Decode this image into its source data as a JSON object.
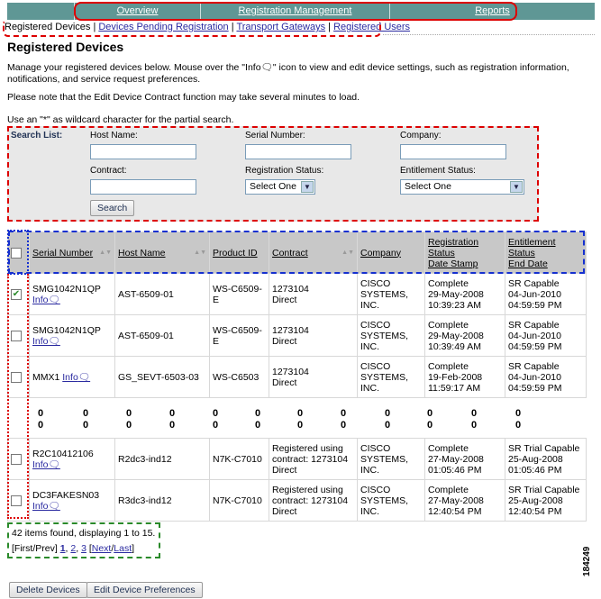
{
  "nav": {
    "items": [
      "Overview",
      "Registration Management",
      "Reports"
    ]
  },
  "subnav": {
    "current": "Registered Devices",
    "links": [
      "Devices Pending Registration",
      "Transport Gateways",
      "Registered Users"
    ],
    "sep": "|"
  },
  "title": "Registered Devices",
  "intro": {
    "p1a": "Manage your registered devices below. Mouse over the \"Info",
    "p1b": "\" icon to view and edit device settings, such as registration information, notifications, and service request preferences.",
    "p2": "Please note that the Edit Device Contract function may take several minutes to load.",
    "p3": "Use an \"*\" as wildcard character for the partial search."
  },
  "search": {
    "heading": "Search List:",
    "host_label": "Host Name:",
    "serial_label": "Serial Number:",
    "company_label": "Company:",
    "contract_label": "Contract:",
    "reg_status_label": "Registration Status:",
    "reg_status_value": "Select One",
    "ent_status_label": "Entitlement Status:",
    "ent_status_value": "Select One",
    "search_button": "Search"
  },
  "table": {
    "headers": [
      "Serial Number",
      "Host Name",
      "Product ID",
      "Contract",
      "Company",
      "Registration Status Date Stamp",
      "Entitlement Status End Date"
    ],
    "header_lines": {
      "reg": [
        "Registration",
        "Status",
        "Date Stamp"
      ],
      "ent": [
        "Entitlement Status",
        "End Date"
      ]
    },
    "info_label": "Info",
    "rows": [
      {
        "checked": true,
        "serial": "SMG1042N1QP",
        "host": "AST-6509-01",
        "product": "WS-C6509-E",
        "contract": [
          "1273104",
          "Direct"
        ],
        "company": [
          "CISCO",
          "SYSTEMS, INC."
        ],
        "reg": [
          "Complete",
          "29-May-2008",
          "10:39:23 AM"
        ],
        "ent": [
          "SR Capable",
          "04-Jun-2010",
          "04:59:59 PM"
        ]
      },
      {
        "checked": false,
        "serial": "SMG1042N1QP",
        "host": "AST-6509-01",
        "product": "WS-C6509-E",
        "contract": [
          "1273104",
          "Direct"
        ],
        "company": [
          "CISCO",
          "SYSTEMS, INC."
        ],
        "reg": [
          "Complete",
          "29-May-2008",
          "10:39:49 AM"
        ],
        "ent": [
          "SR Capable",
          "04-Jun-2010",
          "04:59:59 PM"
        ]
      },
      {
        "checked": false,
        "serial": "MMX1",
        "host": "GS_SEVT-6503-03",
        "product": "WS-C6503",
        "contract": [
          "1273104",
          "Direct"
        ],
        "company": [
          "CISCO",
          "SYSTEMS, INC."
        ],
        "reg": [
          "Complete",
          "19-Feb-2008",
          "11:59:17 AM"
        ],
        "ent": [
          "SR Capable",
          "04-Jun-2010",
          "04:59:59 PM"
        ]
      },
      {
        "checked": false,
        "serial": "R2C10412106",
        "host": "R2dc3-ind12",
        "product": "N7K-C7010",
        "contract": [
          "Registered using",
          "contract: 1273104",
          "Direct"
        ],
        "company": [
          "CISCO",
          "SYSTEMS, INC."
        ],
        "reg": [
          "Complete",
          "27-May-2008",
          "01:05:46 PM"
        ],
        "ent": [
          "SR Trial Capable",
          "25-Aug-2008",
          "01:05:46 PM"
        ]
      },
      {
        "checked": false,
        "serial": "DC3FAKESN03",
        "host": "R3dc3-ind12",
        "product": "N7K-C7010",
        "contract": [
          "Registered using",
          "contract: 1273104",
          "Direct"
        ],
        "company": [
          "CISCO",
          "SYSTEMS, INC."
        ],
        "reg": [
          "Complete",
          "27-May-2008",
          "12:40:54 PM"
        ],
        "ent": [
          "SR Trial Capable",
          "25-Aug-2008",
          "12:40:54 PM"
        ]
      }
    ],
    "ellipsis": "0"
  },
  "pager": {
    "summary": "42 items found, displaying 1 to 15.",
    "first_prev": "[First/Prev]",
    "pages": [
      "1",
      "2",
      "3"
    ],
    "next": "Next",
    "last": "Last"
  },
  "buttons": {
    "delete": "Delete Devices",
    "edit_prefs": "Edit Device Preferences"
  },
  "figure_id": "184249"
}
